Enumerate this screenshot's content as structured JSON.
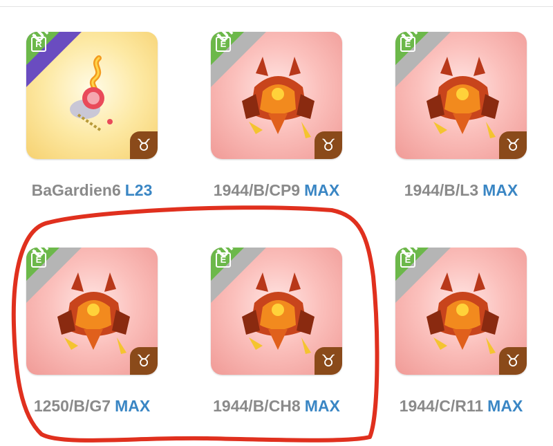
{
  "cards": [
    {
      "name": "BaGardien6",
      "level": "L23",
      "tier": "Ultra",
      "rarity_badge": "R",
      "theme": "gold",
      "creature": "flame-spirit",
      "zodiac": "♉"
    },
    {
      "name": "1944/B/CP9",
      "level": "MAX",
      "tier": "Ultra",
      "rarity_badge": "E",
      "theme": "pink",
      "creature": "fire-armor-beast",
      "zodiac": "♉"
    },
    {
      "name": "1944/B/L3",
      "level": "MAX",
      "tier": "Ultra",
      "rarity_badge": "E",
      "theme": "pink",
      "creature": "fire-armor-beast",
      "zodiac": "♉"
    },
    {
      "name": "1250/B/G7",
      "level": "MAX",
      "tier": "Ultra",
      "rarity_badge": "E",
      "theme": "pink",
      "creature": "fire-armor-beast",
      "zodiac": "♉"
    },
    {
      "name": "1944/B/CH8",
      "level": "MAX",
      "tier": "Ultra",
      "rarity_badge": "E",
      "theme": "pink",
      "creature": "fire-armor-beast",
      "zodiac": "♉"
    },
    {
      "name": "1944/C/R11",
      "level": "MAX",
      "tier": "Ultra",
      "rarity_badge": "E",
      "theme": "pink",
      "creature": "fire-armor-beast",
      "zodiac": "♉"
    }
  ],
  "colors": {
    "tier_ribbon": "#6cb84a",
    "level_text": "#3a86c4",
    "name_text": "#8a8a8a",
    "annotation": "#e0301e",
    "rare_corner": "#6a4cc0",
    "epic_corner": "#b5b5b5"
  }
}
